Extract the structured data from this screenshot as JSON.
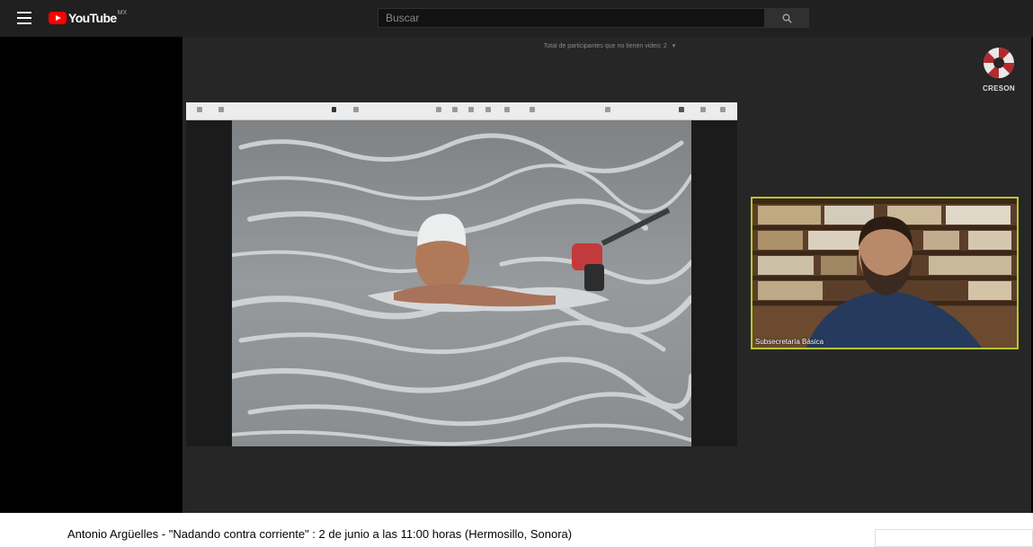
{
  "header": {
    "logo_text": "YouTube",
    "country_code": "MX",
    "search_placeholder": "Buscar"
  },
  "player": {
    "participants_note": "Total de participantes que no tienen video: 2",
    "org_logo_text": "CRESON",
    "camera_label": "Subsecretaría Básica"
  },
  "video": {
    "title": "Antonio Argüelles - \"Nadando contra corriente\" : 2 de junio a las 11:00 horas (Hermosillo, Sonora)"
  },
  "colors": {
    "topbar": "#202020",
    "brand_red": "#ff0000",
    "speaker_highlight": "#b8c62c",
    "stage": "#262626"
  },
  "icons": {
    "menu": "hamburger-menu-icon",
    "search": "magnifier-icon",
    "dropdown": "caret-down-icon"
  }
}
